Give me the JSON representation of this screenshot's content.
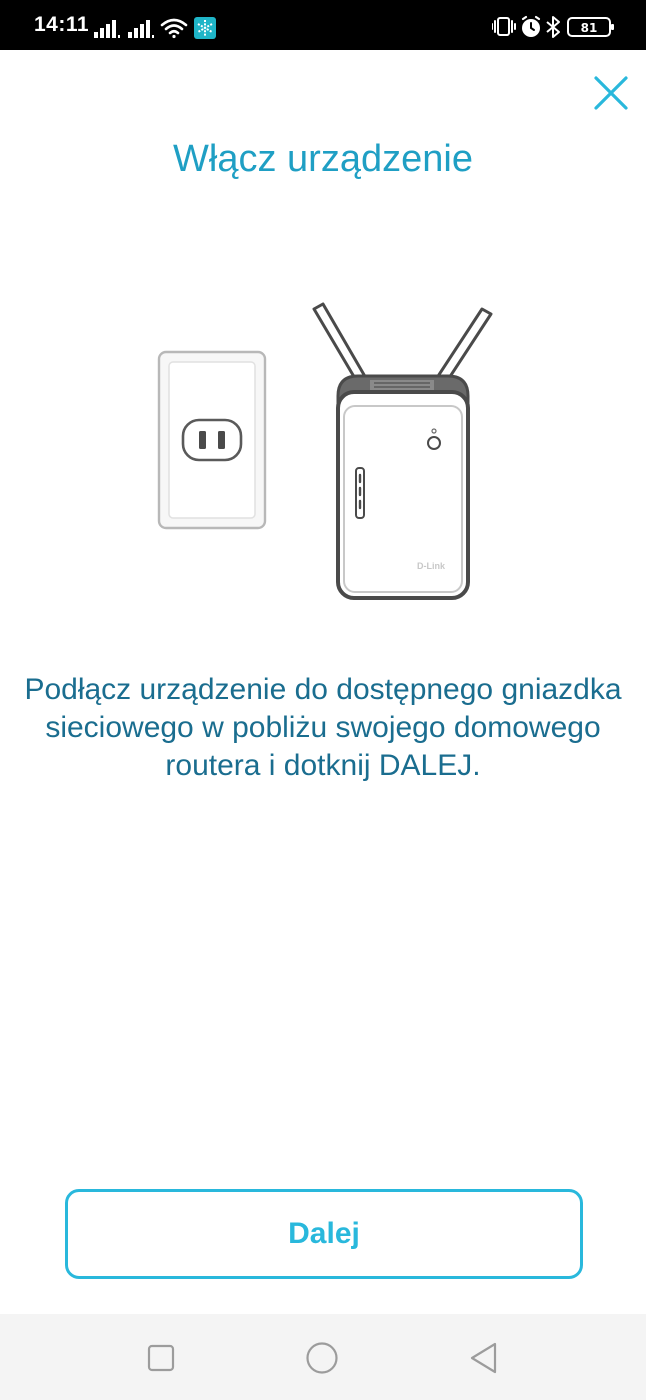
{
  "status_bar": {
    "time": "14:11",
    "battery_level": "81",
    "icons": [
      "signal-1-icon",
      "signal-2-icon",
      "wifi-icon",
      "app-notification-icon",
      "vibrate-icon",
      "alarm-icon",
      "bluetooth-icon",
      "battery-icon"
    ]
  },
  "screen": {
    "title": "Włącz urządzenie",
    "instruction": "Podłącz urządzenie do dostępnego gniazdka sieciowego w pobliżu swojego domowego routera i dotknij DALEJ.",
    "illustration": {
      "icons": [
        "wall-outlet-icon",
        "range-extender-icon"
      ],
      "brand": "D-Link"
    },
    "close_icon": "close-icon",
    "next_label": "Dalej"
  },
  "nav_bar": {
    "icons": [
      "recent-apps-icon",
      "home-icon",
      "back-icon"
    ]
  },
  "colors": {
    "title": "#1f9fc4",
    "instruction": "#1a6d8f",
    "accent": "#29b8dc",
    "status_bar": "#000000",
    "nav_bar": "#f4f4f4"
  }
}
